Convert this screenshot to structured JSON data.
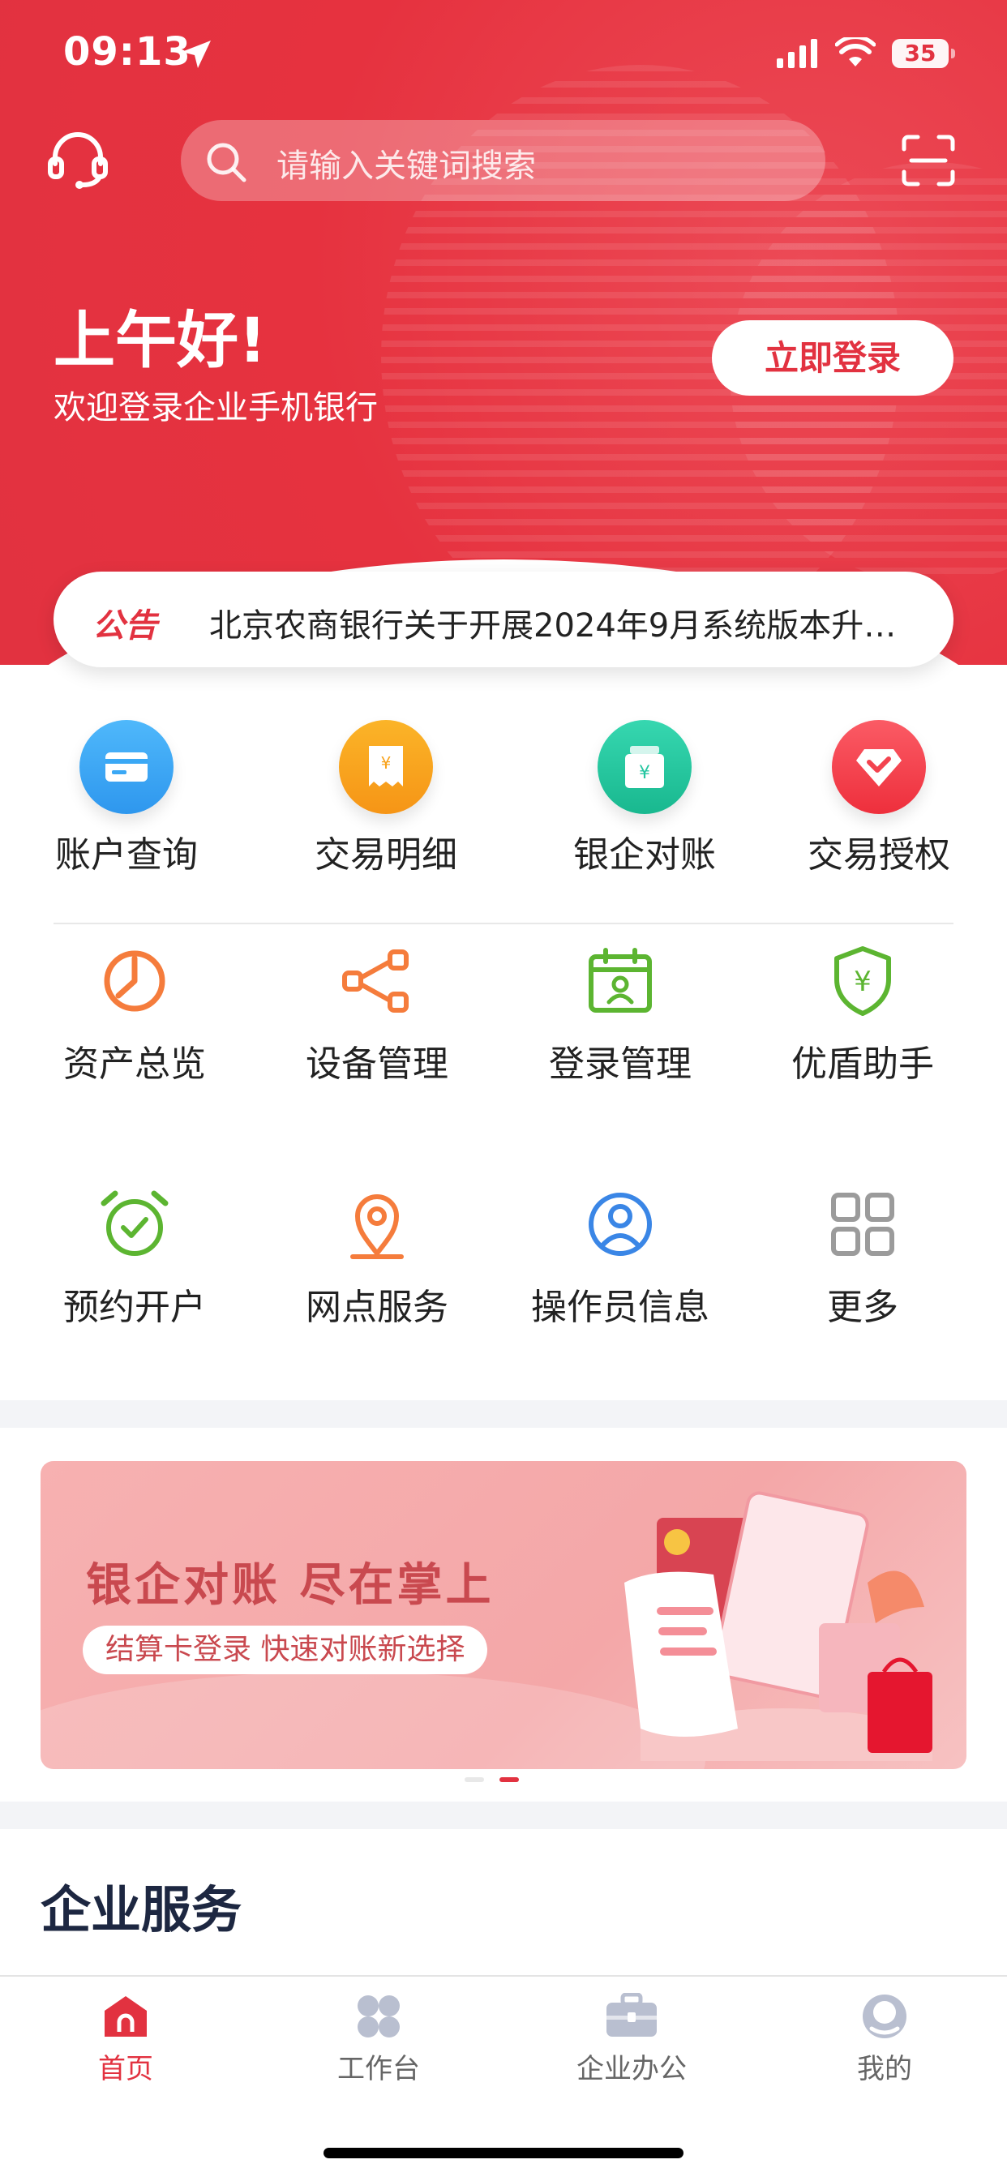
{
  "status_bar": {
    "time": "09:13",
    "battery": "35"
  },
  "header": {
    "search_placeholder": "请输入关键词搜索"
  },
  "greeting": {
    "title": "上午好!",
    "subtitle": "欢迎登录企业手机银行",
    "login_button": "立即登录"
  },
  "notice": {
    "tag": "公告",
    "text": "北京农商银行关于开展2024年9月系统版本升…"
  },
  "main_services": [
    {
      "label": "账户查询",
      "icon": "card-icon",
      "color": "#3aa8f5"
    },
    {
      "label": "交易明细",
      "icon": "receipt-icon",
      "color": "#f8a21a"
    },
    {
      "label": "银企对账",
      "icon": "ledger-icon",
      "color": "#24c6a0"
    },
    {
      "label": "交易授权",
      "icon": "diamond-check-icon",
      "color": "#f3434f"
    }
  ],
  "service_grid": [
    {
      "label": "资产总览",
      "icon": "pie-chart-icon",
      "color": "#f57c3c"
    },
    {
      "label": "设备管理",
      "icon": "share-nodes-icon",
      "color": "#f57c3c"
    },
    {
      "label": "登录管理",
      "icon": "calendar-user-icon",
      "color": "#5cb531"
    },
    {
      "label": "优盾助手",
      "icon": "shield-yuan-icon",
      "color": "#5cb531"
    },
    {
      "label": "预约开户",
      "icon": "alarm-clock-icon",
      "color": "#5cb531"
    },
    {
      "label": "网点服务",
      "icon": "location-pin-icon",
      "color": "#f57c3c"
    },
    {
      "label": "操作员信息",
      "icon": "user-circle-icon",
      "color": "#3a86e6"
    },
    {
      "label": "更多",
      "icon": "grid-icon",
      "color": "#9b9b9b"
    }
  ],
  "banner": {
    "title": "银企对账  尽在掌上",
    "subtitle": "结算卡登录  快速对账新选择",
    "active_slide": 2,
    "slide_count": 2
  },
  "sections": {
    "enterprise_title": "企业服务"
  },
  "tabbar": [
    {
      "label": "首页",
      "icon": "home-icon",
      "active": true
    },
    {
      "label": "工作台",
      "icon": "workbench-icon",
      "active": false
    },
    {
      "label": "企业办公",
      "icon": "briefcase-icon",
      "active": false
    },
    {
      "label": "我的",
      "icon": "profile-icon",
      "active": false
    }
  ],
  "colors": {
    "brand_red": "#e23240",
    "text_dark": "#222222",
    "section_title": "#1d2741"
  }
}
